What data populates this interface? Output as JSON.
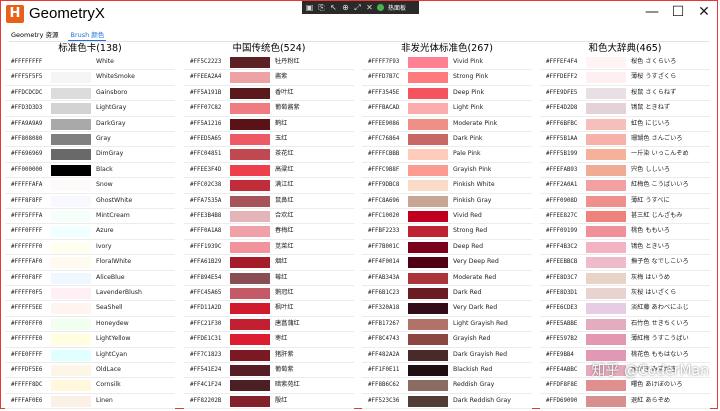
{
  "window": {
    "title": "GeometryX",
    "logo": "H",
    "toolbar_label": "热面板",
    "controls": [
      "minimize-icon",
      "maximize-icon",
      "close-icon"
    ]
  },
  "tabs": [
    {
      "label": "Geometry 资源",
      "active": false
    },
    {
      "label": "Brush 颜色",
      "active": true
    }
  ],
  "accent_color": "#1e6fd9",
  "columns": [
    {
      "title": "标准色卡(138)",
      "rows": [
        {
          "hex": "#FFFFFFFF",
          "name": "White",
          "color": "#FFFFFF"
        },
        {
          "hex": "#FFF5F5F5",
          "name": "WhiteSmoke",
          "color": "#F5F5F5"
        },
        {
          "hex": "#FFDCDCDC",
          "name": "Gainsboro",
          "color": "#DCDCDC"
        },
        {
          "hex": "#FFD3D3D3",
          "name": "LightGray",
          "color": "#D3D3D3"
        },
        {
          "hex": "#FFA9A9A9",
          "name": "DarkGray",
          "color": "#A9A9A9"
        },
        {
          "hex": "#FF808080",
          "name": "Gray",
          "color": "#808080"
        },
        {
          "hex": "#FF696969",
          "name": "DimGray",
          "color": "#696969"
        },
        {
          "hex": "#FF000000",
          "name": "Black",
          "color": "#000000"
        },
        {
          "hex": "#FFFFFAFA",
          "name": "Snow",
          "color": "#FFFAFA"
        },
        {
          "hex": "#FFF8F8FF",
          "name": "GhostWhite",
          "color": "#F8F8FF"
        },
        {
          "hex": "#FFF5FFFA",
          "name": "MintCream",
          "color": "#F5FFFA"
        },
        {
          "hex": "#FFF0FFFF",
          "name": "Azure",
          "color": "#F0FFFF"
        },
        {
          "hex": "#FFFFFFF0",
          "name": "Ivory",
          "color": "#FFFFF0"
        },
        {
          "hex": "#FFFFFAF0",
          "name": "FloralWhite",
          "color": "#FFFAF0"
        },
        {
          "hex": "#FFF0F8FF",
          "name": "AliceBlue",
          "color": "#F0F8FF"
        },
        {
          "hex": "#FFFFF0F5",
          "name": "LavenderBlush",
          "color": "#FFF0F5"
        },
        {
          "hex": "#FFFFF5EE",
          "name": "SeaShell",
          "color": "#FFF5EE"
        },
        {
          "hex": "#FFF0FFF0",
          "name": "Honeydew",
          "color": "#F0FFF0"
        },
        {
          "hex": "#FFFFFFE0",
          "name": "LightYellow",
          "color": "#FFFFE0"
        },
        {
          "hex": "#FFE0FFFF",
          "name": "LightCyan",
          "color": "#E0FFFF"
        },
        {
          "hex": "#FFFDF5E6",
          "name": "OldLace",
          "color": "#FDF5E6"
        },
        {
          "hex": "#FFFFF8DC",
          "name": "Cornsilk",
          "color": "#FFF8DC"
        },
        {
          "hex": "#FFFAF0E6",
          "name": "Linen",
          "color": "#FAF0E6"
        }
      ]
    },
    {
      "title": "中国传统色(524)",
      "rows": [
        {
          "hex": "#FF5C2223",
          "name": "牡丹粉红",
          "color": "#5C2223"
        },
        {
          "hex": "#FFEEA2A4",
          "name": "酱紫",
          "color": "#EEA2A4"
        },
        {
          "hex": "#FF5A191B",
          "name": "香叶红",
          "color": "#5A191B"
        },
        {
          "hex": "#FFF07C82",
          "name": "葡萄酱紫",
          "color": "#F07C82"
        },
        {
          "hex": "#FF5A1216",
          "name": "鹤红",
          "color": "#5A1216"
        },
        {
          "hex": "#FFED5A65",
          "name": "玉红",
          "color": "#ED5A65"
        },
        {
          "hex": "#FFC04851",
          "name": "茶花红",
          "color": "#C04851"
        },
        {
          "hex": "#FFEE3F4D",
          "name": "高粱红",
          "color": "#EE3F4D"
        },
        {
          "hex": "#FFC02C38",
          "name": "满江红",
          "color": "#C02C38"
        },
        {
          "hex": "#FFA7535A",
          "name": "鼠鼻红",
          "color": "#A7535A"
        },
        {
          "hex": "#FFE3B4B8",
          "name": "合欢红",
          "color": "#E3B4B8"
        },
        {
          "hex": "#FFF0A1A8",
          "name": "春梅红",
          "color": "#F0A1A8"
        },
        {
          "hex": "#FFF1939C",
          "name": "苋菜红",
          "color": "#F1939C"
        },
        {
          "hex": "#FFA61B29",
          "name": "烟红",
          "color": "#A61B29"
        },
        {
          "hex": "#FF894E54",
          "name": "莓红",
          "color": "#894E54"
        },
        {
          "hex": "#FFC45A65",
          "name": "鹅冠红",
          "color": "#C45A65"
        },
        {
          "hex": "#FFD11A2D",
          "name": "枫叶红",
          "color": "#D11A2D"
        },
        {
          "hex": "#FFC21F30",
          "name": "唐菖蒲红",
          "color": "#C21F30"
        },
        {
          "hex": "#FFDE1C31",
          "name": "枣红",
          "color": "#DE1C31"
        },
        {
          "hex": "#FF7C1823",
          "name": "猪肝紫",
          "color": "#7C1823"
        },
        {
          "hex": "#FF541E24",
          "name": "葡萄紫",
          "color": "#541E24"
        },
        {
          "hex": "#FF4C1F24",
          "name": "暗紫苑红",
          "color": "#4C1F24"
        },
        {
          "hex": "#FF82202B",
          "name": "殷红",
          "color": "#82202B"
        }
      ]
    },
    {
      "title": "非发光体标准色(267)",
      "rows": [
        {
          "hex": "#FFFF7F93",
          "name": "Vivid Pink",
          "color": "#FF7F93"
        },
        {
          "hex": "#FFFD7B7C",
          "name": "Strong Pink",
          "color": "#FD7B7C"
        },
        {
          "hex": "#FFF3545E",
          "name": "Deep Pink",
          "color": "#F3545E"
        },
        {
          "hex": "#FFFBACAD",
          "name": "Light Pink",
          "color": "#FBACAD"
        },
        {
          "hex": "#FFEE9086",
          "name": "Moderate Pink",
          "color": "#EE9086"
        },
        {
          "hex": "#FFC76864",
          "name": "Dark Pink",
          "color": "#C76864"
        },
        {
          "hex": "#FFFFCBBB",
          "name": "Pale Pink",
          "color": "#FFCBBB"
        },
        {
          "hex": "#FFFC9B8F",
          "name": "Grayish Pink",
          "color": "#FC9B8F"
        },
        {
          "hex": "#FFF9DBC8",
          "name": "Pinkish White",
          "color": "#F9DBC8"
        },
        {
          "hex": "#FFC8A696",
          "name": "Pinkish Gray",
          "color": "#C8A696"
        },
        {
          "hex": "#FFC10020",
          "name": "Vivid Red",
          "color": "#C10020"
        },
        {
          "hex": "#FFBF2233",
          "name": "Strong Red",
          "color": "#BF2233"
        },
        {
          "hex": "#FF7B001C",
          "name": "Deep Red",
          "color": "#7B001C"
        },
        {
          "hex": "#FF4F0014",
          "name": "Very Deep Red",
          "color": "#4F0014"
        },
        {
          "hex": "#FFAB343A",
          "name": "Moderate Red",
          "color": "#AB343A"
        },
        {
          "hex": "#FF6B1C23",
          "name": "Dark Red",
          "color": "#6B1C23"
        },
        {
          "hex": "#FF320A18",
          "name": "Very Dark Red",
          "color": "#320A18"
        },
        {
          "hex": "#FFB17267",
          "name": "Light Grayish Red",
          "color": "#B17267"
        },
        {
          "hex": "#FF8C4743",
          "name": "Grayish Red",
          "color": "#8C4743"
        },
        {
          "hex": "#FF482A2A",
          "name": "Dark Grayish Red",
          "color": "#482A2A"
        },
        {
          "hex": "#FF1F0E11",
          "name": "Blackish Red",
          "color": "#1F0E11"
        },
        {
          "hex": "#FF8B6C62",
          "name": "Reddish Gray",
          "color": "#8B6C62"
        },
        {
          "hex": "#FF523C36",
          "name": "Dark Reddish Gray",
          "color": "#523C36"
        }
      ]
    },
    {
      "title": "和色大辞典(465)",
      "rows": [
        {
          "hex": "#FFFEF4F4",
          "name": "桜色 さくらいろ",
          "color": "#FEF4F4"
        },
        {
          "hex": "#FFFDEFF2",
          "name": "薄桜 うすざくら",
          "color": "#FDEFF2"
        },
        {
          "hex": "#FFE9DFE5",
          "name": "桜鼠 さくらねず",
          "color": "#E9DFE5"
        },
        {
          "hex": "#FFE4D2D8",
          "name": "鴇鼠 ときねず",
          "color": "#E4D2D8"
        },
        {
          "hex": "#FFF6BFBC",
          "name": "虹色 にじいろ",
          "color": "#F6BFBC"
        },
        {
          "hex": "#FFF5B1AA",
          "name": "珊瑚色 さんごいろ",
          "color": "#F5B1AA"
        },
        {
          "hex": "#FFF5B199",
          "name": "一斤染 いっこんぞめ",
          "color": "#F5B199"
        },
        {
          "hex": "#FFEFAB93",
          "name": "宍色 ししいろ",
          "color": "#EFAB93"
        },
        {
          "hex": "#FFF2A0A1",
          "name": "紅梅色 こうばいいろ",
          "color": "#F2A0A1"
        },
        {
          "hex": "#FFF0908D",
          "name": "薄紅 うすべに",
          "color": "#F0908D"
        },
        {
          "hex": "#FFEE827C",
          "name": "甚三紅 じんざもみ",
          "color": "#EE827C"
        },
        {
          "hex": "#FFF09199",
          "name": "桃色 ももいろ",
          "color": "#F09199"
        },
        {
          "hex": "#FFF4B3C2",
          "name": "鴇色 ときいろ",
          "color": "#F4B3C2"
        },
        {
          "hex": "#FFEEBBCB",
          "name": "撫子色 なでしこいろ",
          "color": "#EEBBCB"
        },
        {
          "hex": "#FFE8D3C7",
          "name": "灰梅 はいうめ",
          "color": "#E8D3C7"
        },
        {
          "hex": "#FFE8D3D1",
          "name": "灰桜 はいざくら",
          "color": "#E8D3D1"
        },
        {
          "hex": "#FFE6CDE3",
          "name": "淡紅藤 あわべにふじ",
          "color": "#E6CDE3"
        },
        {
          "hex": "#FFE5ABBE",
          "name": "石竹色 せきちくいろ",
          "color": "#E5ABBE"
        },
        {
          "hex": "#FFE597B2",
          "name": "薄紅梅 うすこうばい",
          "color": "#E597B2"
        },
        {
          "hex": "#FFE9BB4",
          "name": "桃花色 ももはないろ",
          "color": "#E198B4"
        },
        {
          "hex": "#FFE4ABBC",
          "name": "水がき みずがき",
          "color": "#E4ABBC"
        },
        {
          "hex": "#FFDF8F8E",
          "name": "曙色 あけぼのいろ",
          "color": "#DF8F8E"
        },
        {
          "hex": "#FFD69090",
          "name": "退紅 あらぞめ",
          "color": "#D69090"
        }
      ]
    }
  ],
  "watermark": "知乎 @CoderMan"
}
